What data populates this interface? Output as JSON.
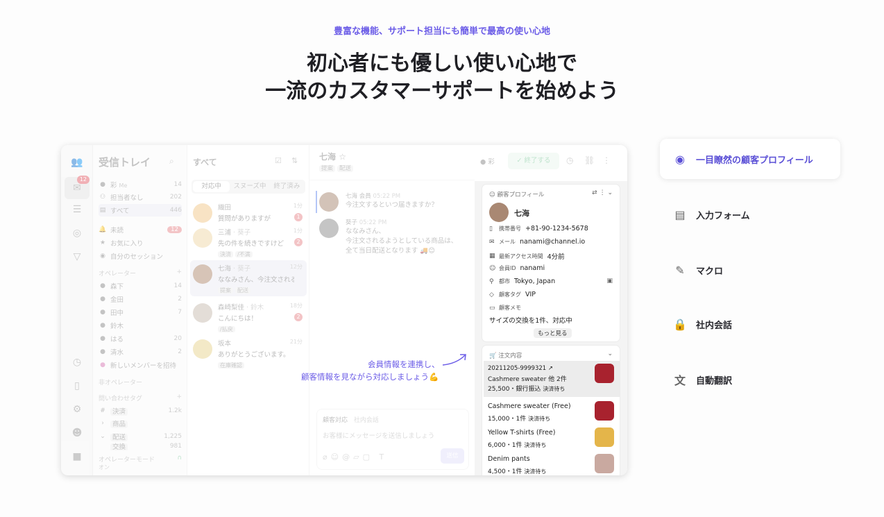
{
  "hero": {
    "eyebrow": "豊富な機能、サポート担当にも簡単で最高の使い心地",
    "headline_line1": "初心者にも優しい使い心地で",
    "headline_line2": "一流のカスタマーサポートを始めよう"
  },
  "app": {
    "rail_badge": "12",
    "inbox": {
      "title": "受信トレイ",
      "items": [
        {
          "label": "彩",
          "tag": "Me",
          "count": "14"
        },
        {
          "label": "担当者なし",
          "count": "202"
        },
        {
          "label": "すべて",
          "count": "446"
        }
      ],
      "unread_label": "未読",
      "unread_count": "12",
      "favorites_label": "お気に入り",
      "own_session_label": "自分のセッション",
      "operators_section": "オペレーター",
      "operators": [
        {
          "name": "森下",
          "count": "14"
        },
        {
          "name": "金田",
          "count": "2"
        },
        {
          "name": "田中",
          "count": "7"
        },
        {
          "name": "鈴木",
          "count": ""
        },
        {
          "name": "はる",
          "count": "20"
        },
        {
          "name": "清水",
          "count": "2"
        }
      ],
      "invite_label": "新しいメンバーを招待",
      "non_operator_section": "非オペレーター",
      "tags_section": "問い合わせタグ",
      "tags": [
        {
          "name": "決済",
          "count": "1.2k"
        },
        {
          "name": "商品",
          "count": ""
        },
        {
          "name": "配送",
          "count": "1,225"
        },
        {
          "name": "交換",
          "count": "981"
        }
      ],
      "operator_mode_label": "オペレーターモード",
      "operator_mode_value": "オン"
    },
    "list": {
      "title": "すべて",
      "tabs": [
        "対応中",
        "スヌーズ中",
        "終了済み"
      ],
      "conversations": [
        {
          "name": "織田",
          "assignee": "",
          "time": "1分",
          "message": "質問がありますが",
          "tags": [],
          "unread": "1"
        },
        {
          "name": "三浦",
          "assignee": "· 葵子",
          "time": "1分",
          "message": "先の件を続きですけど",
          "tags": [
            "決済",
            "/不満"
          ],
          "unread": "2"
        },
        {
          "name": "七海",
          "assignee": "· 葵子",
          "time": "12分",
          "message": "ななみさん、今注文される…",
          "tags": [
            "提案",
            "配送"
          ],
          "unread": ""
        },
        {
          "name": "森崎梨佳",
          "assignee": "· 鈴木",
          "time": "18分",
          "message": "こんにちは！",
          "tags": [
            "/払戻"
          ],
          "unread": "2"
        },
        {
          "name": "坂本",
          "assignee": "",
          "time": "21分",
          "message": "ありがとうございます。",
          "tags": [
            "在庫確認"
          ],
          "unread": ""
        }
      ]
    },
    "chat": {
      "name": "七海",
      "tags": [
        "提案",
        "配送"
      ],
      "messages": [
        {
          "sender": "七海",
          "role": "会員",
          "time": "05:22 PM",
          "text": "今注文するといつ届きますか？"
        },
        {
          "sender": "葵子",
          "role": "",
          "time": "05:22 PM",
          "text": "ななみさん、\n今注文されるようとしている商品は、\n全て当日配送となります 🚚😊"
        }
      ],
      "composer_tabs": [
        "顧客対応",
        "社内会話"
      ],
      "composer_placeholder": "お客様にメッセージを送信しましょう",
      "send_label": "送信"
    },
    "topbar": {
      "assignee": "彩",
      "end_label": "終了する"
    },
    "profile": {
      "header": "顧客プロフィール",
      "name": "七海",
      "fields": [
        {
          "icon": "phone-icon",
          "key": "携帯番号",
          "value": "+81-90-1234-5678"
        },
        {
          "icon": "mail-icon",
          "key": "メール",
          "value": "nanami@channel.io"
        },
        {
          "icon": "calendar-icon",
          "key": "最新アクセス時間",
          "value": "4分前"
        },
        {
          "icon": "person-icon",
          "key": "会員ID",
          "value": "nanami"
        },
        {
          "icon": "pin-icon",
          "key": "都市",
          "value": "Tokyo, Japan"
        },
        {
          "icon": "tag-icon",
          "key": "顧客タグ",
          "value": "VIP"
        },
        {
          "icon": "memo-icon",
          "key": "顧客メモ",
          "value": ""
        }
      ],
      "memo": "サイズの交換を1件、対応中",
      "more_label": "もっと見る"
    },
    "orders": {
      "header": "注文内容",
      "items": [
        {
          "line1": "20211205-9999321",
          "line2": "Cashmere sweater 他 2件",
          "line3": "25,500・銀行振込",
          "status": "決済待ち"
        },
        {
          "line1": "Cashmere sweater (Free)",
          "line2": "15,000・1件",
          "status": "決済待ち"
        },
        {
          "line1": "Yellow T-shirts (Free)",
          "line2": "6,000・1件",
          "status": "決済待ち"
        },
        {
          "line1": "Denim pants",
          "line2": "4,500・1件",
          "status": "決済待ち"
        }
      ]
    }
  },
  "annotation": {
    "line1": "会員情報を連携し、",
    "line2": "顧客情報を見ながら対応しましょう💪"
  },
  "features": [
    {
      "icon": "profile-icon",
      "label": "一目瞭然の顧客プロフィール",
      "active": true
    },
    {
      "icon": "clipboard-icon",
      "label": "入力フォーム",
      "active": false
    },
    {
      "icon": "macro-icon",
      "label": "マクロ",
      "active": false
    },
    {
      "icon": "lock-icon",
      "label": "社内会話",
      "active": false
    },
    {
      "icon": "translate-icon",
      "label": "自動翻訳",
      "active": false
    }
  ],
  "colors": {
    "accent": "#6b5ce7",
    "unread": "#e4646d",
    "end_button": "#eaf6ee"
  }
}
